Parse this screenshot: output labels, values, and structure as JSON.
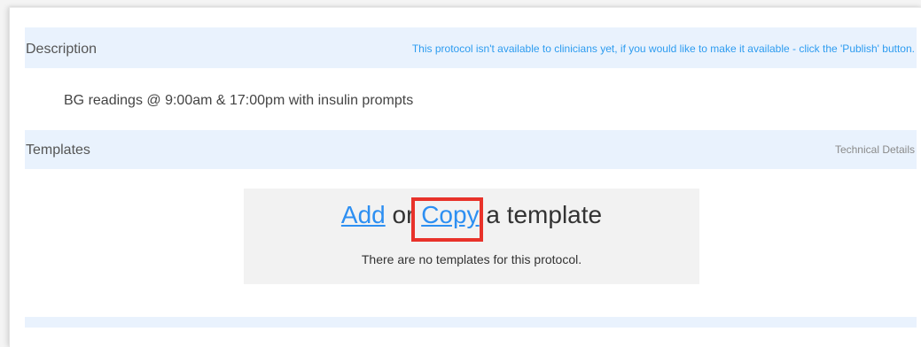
{
  "description_section": {
    "title": "Description",
    "publish_notice": "This protocol isn't available to clinicians yet, if you would like to make it available - click the 'Publish' button.",
    "text": "BG readings @ 9:00am & 17:00pm with insulin prompts"
  },
  "templates_section": {
    "title": "Templates",
    "technical_details_label": "Technical Details",
    "empty_state": {
      "add_link": "Add",
      "or_text": "or",
      "copy_link": "Copy",
      "suffix_text": "a template",
      "message": "There are no templates for this protocol."
    }
  },
  "colors": {
    "section_bar": "#e9f2fd",
    "link": "#2d8ff2",
    "notice": "#2d9cf0",
    "highlight": "#e8322a",
    "empty_box": "#f2f2f2"
  }
}
